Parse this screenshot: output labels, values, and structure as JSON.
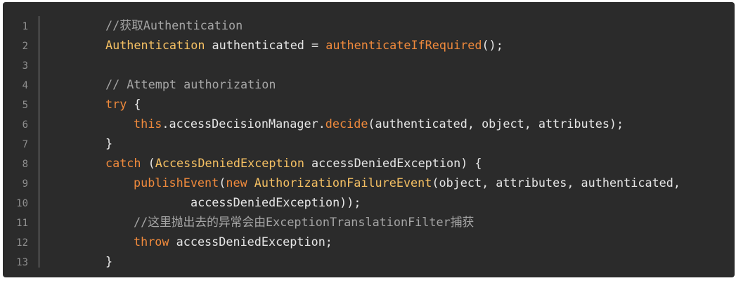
{
  "line_numbers": [
    "1",
    "2",
    "3",
    "4",
    "5",
    "6",
    "7",
    "8",
    "9",
    "10",
    "11",
    "12",
    "13"
  ],
  "code": {
    "l1": {
      "comment": "//获取Authentication"
    },
    "l2": {
      "type": "Authentication",
      "t1": " authenticated = ",
      "func": "authenticateIfRequired",
      "t2": "();"
    },
    "l3": {},
    "l4": {
      "comment": "// Attempt authorization"
    },
    "l5": {
      "kw": "try",
      "t1": " {"
    },
    "l6": {
      "kw": "this",
      "t1": ".accessDecisionManager.",
      "func": "decide",
      "t2": "(authenticated, object, attributes);"
    },
    "l7": {
      "t1": "}"
    },
    "l8": {
      "kw": "catch",
      "t1": " (",
      "type": "AccessDeniedException",
      "t2": " accessDeniedException) {"
    },
    "l9": {
      "func": "publishEvent",
      "t1": "(",
      "kw": "new",
      "t2": " ",
      "type": "AuthorizationFailureEvent",
      "t3": "(object, attributes, authenticated,"
    },
    "l10": {
      "t1": "accessDeniedException));"
    },
    "l11": {
      "comment": "//这里抛出去的异常会由ExceptionTranslationFilter捕获"
    },
    "l12": {
      "kw": "throw",
      "t1": " accessDeniedException;"
    },
    "l13": {
      "t1": "}"
    }
  },
  "colors": {
    "background": "#2b2b2b",
    "comment": "#a5a5a5",
    "type": "#f5c063",
    "keyword_function": "#f08a3c",
    "plain": "#e6e6e6",
    "line_number": "#8f8f8f"
  }
}
